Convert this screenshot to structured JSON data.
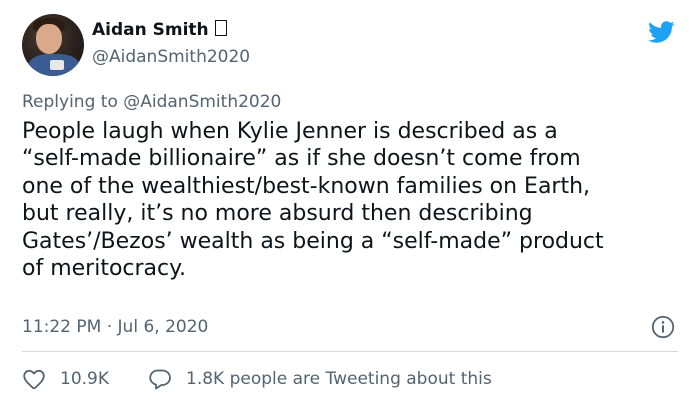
{
  "author": {
    "display_name": "Aidan Smith",
    "handle": "@AidanSmith2020"
  },
  "reply_context": "Replying to @AidanSmith2020",
  "tweet": {
    "text": "People laugh when Kylie Jenner is described as a\n“self-made billionaire” as if she doesn’t come from\none of the wealthiest/best-known families on Earth,\nbut really, it’s no more absurd then describing\nGates’/Bezos’ wealth as being a “self-made” product\nof meritocracy.",
    "timestamp": "11:22 PM · Jul 6, 2020"
  },
  "actions": {
    "likes": "10.9K",
    "reply_text": "1.8K people are Tweeting about this"
  },
  "icons": {
    "brand": "twitter-bird-icon",
    "info": "info-icon",
    "like": "heart-icon",
    "reply": "speech-bubble-icon"
  },
  "colors": {
    "twitter_blue": "#1da1f2",
    "secondary_text": "#536471",
    "primary_text": "#0f1419",
    "divider": "#cfd9de"
  }
}
